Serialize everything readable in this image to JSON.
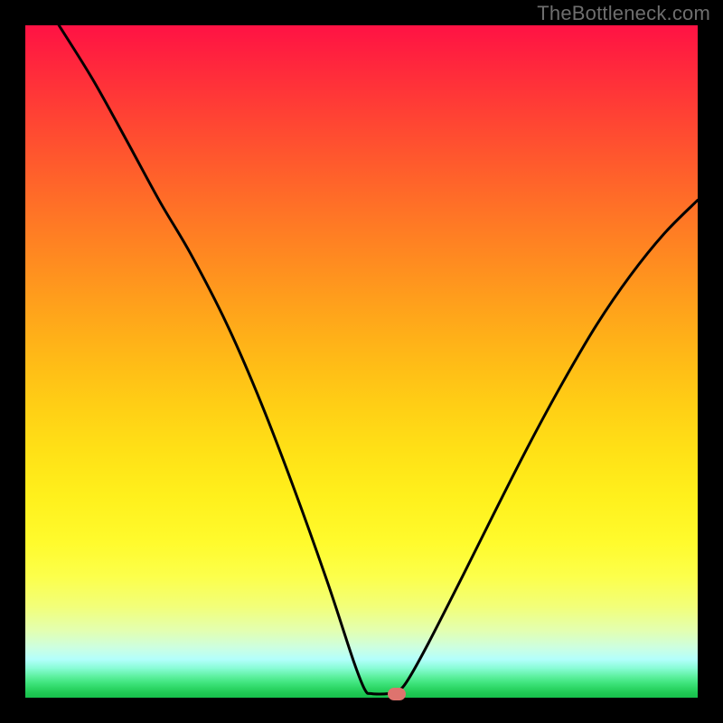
{
  "watermark": "TheBottleneck.com",
  "chart_data": {
    "type": "line",
    "title": "",
    "xlabel": "",
    "ylabel": "",
    "xlim": [
      0,
      1
    ],
    "ylim": [
      0,
      1
    ],
    "background_gradient": {
      "top": "#ff1244",
      "bottom": "#18bf4c",
      "description": "vertical rainbow gradient from red (top) through orange, yellow, pale yellow, to green (bottom)"
    },
    "series": [
      {
        "name": "curve",
        "color": "#000000",
        "points": [
          {
            "x": 0.05,
            "y": 1.0
          },
          {
            "x": 0.1,
            "y": 0.92
          },
          {
            "x": 0.15,
            "y": 0.83
          },
          {
            "x": 0.2,
            "y": 0.738
          },
          {
            "x": 0.246,
            "y": 0.66
          },
          {
            "x": 0.3,
            "y": 0.555
          },
          {
            "x": 0.35,
            "y": 0.44
          },
          {
            "x": 0.4,
            "y": 0.31
          },
          {
            "x": 0.45,
            "y": 0.17
          },
          {
            "x": 0.488,
            "y": 0.055
          },
          {
            "x": 0.505,
            "y": 0.012
          },
          {
            "x": 0.515,
            "y": 0.006
          },
          {
            "x": 0.54,
            "y": 0.006
          },
          {
            "x": 0.555,
            "y": 0.01
          },
          {
            "x": 0.57,
            "y": 0.028
          },
          {
            "x": 0.6,
            "y": 0.082
          },
          {
            "x": 0.65,
            "y": 0.18
          },
          {
            "x": 0.7,
            "y": 0.28
          },
          {
            "x": 0.75,
            "y": 0.378
          },
          {
            "x": 0.8,
            "y": 0.47
          },
          {
            "x": 0.85,
            "y": 0.555
          },
          {
            "x": 0.9,
            "y": 0.628
          },
          {
            "x": 0.95,
            "y": 0.69
          },
          {
            "x": 1.0,
            "y": 0.74
          }
        ]
      }
    ],
    "marker": {
      "x": 0.552,
      "y": 0.005,
      "color": "#de736e",
      "w": 20,
      "h": 14
    }
  }
}
